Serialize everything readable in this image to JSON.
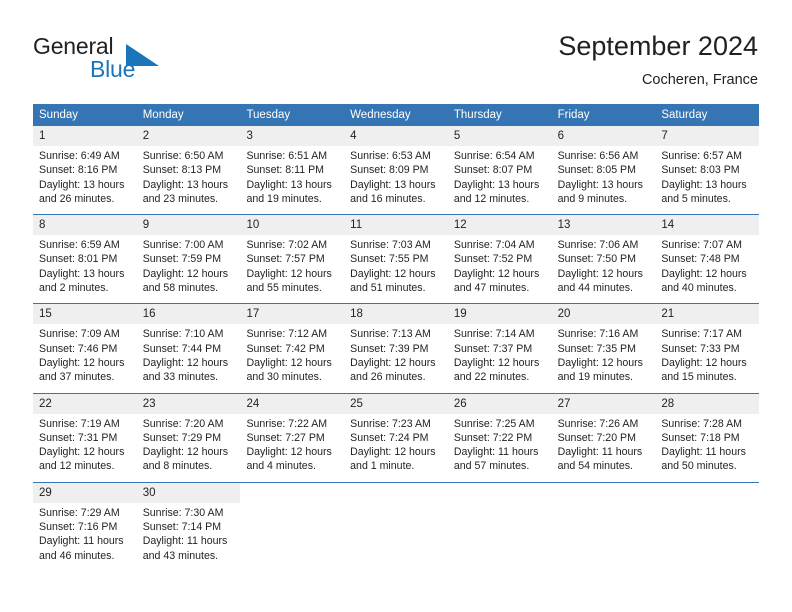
{
  "brand": {
    "word1": "General",
    "word2": "Blue",
    "mark_icon": "triangle-logo-icon",
    "colors": {
      "text": "#231f20",
      "blue": "#1b75bb"
    }
  },
  "header": {
    "title": "September 2024",
    "location": "Cocheren, France"
  },
  "theme": {
    "header_blue": "#3575b3",
    "day_band_gray": "#efefef",
    "text": "#231f20"
  },
  "weekdays": [
    "Sunday",
    "Monday",
    "Tuesday",
    "Wednesday",
    "Thursday",
    "Friday",
    "Saturday"
  ],
  "weeks": [
    [
      {
        "day": "1",
        "sunrise": "Sunrise: 6:49 AM",
        "sunset": "Sunset: 8:16 PM",
        "daylight": "Daylight: 13 hours and 26 minutes."
      },
      {
        "day": "2",
        "sunrise": "Sunrise: 6:50 AM",
        "sunset": "Sunset: 8:13 PM",
        "daylight": "Daylight: 13 hours and 23 minutes."
      },
      {
        "day": "3",
        "sunrise": "Sunrise: 6:51 AM",
        "sunset": "Sunset: 8:11 PM",
        "daylight": "Daylight: 13 hours and 19 minutes."
      },
      {
        "day": "4",
        "sunrise": "Sunrise: 6:53 AM",
        "sunset": "Sunset: 8:09 PM",
        "daylight": "Daylight: 13 hours and 16 minutes."
      },
      {
        "day": "5",
        "sunrise": "Sunrise: 6:54 AM",
        "sunset": "Sunset: 8:07 PM",
        "daylight": "Daylight: 13 hours and 12 minutes."
      },
      {
        "day": "6",
        "sunrise": "Sunrise: 6:56 AM",
        "sunset": "Sunset: 8:05 PM",
        "daylight": "Daylight: 13 hours and 9 minutes."
      },
      {
        "day": "7",
        "sunrise": "Sunrise: 6:57 AM",
        "sunset": "Sunset: 8:03 PM",
        "daylight": "Daylight: 13 hours and 5 minutes."
      }
    ],
    [
      {
        "day": "8",
        "sunrise": "Sunrise: 6:59 AM",
        "sunset": "Sunset: 8:01 PM",
        "daylight": "Daylight: 13 hours and 2 minutes."
      },
      {
        "day": "9",
        "sunrise": "Sunrise: 7:00 AM",
        "sunset": "Sunset: 7:59 PM",
        "daylight": "Daylight: 12 hours and 58 minutes."
      },
      {
        "day": "10",
        "sunrise": "Sunrise: 7:02 AM",
        "sunset": "Sunset: 7:57 PM",
        "daylight": "Daylight: 12 hours and 55 minutes."
      },
      {
        "day": "11",
        "sunrise": "Sunrise: 7:03 AM",
        "sunset": "Sunset: 7:55 PM",
        "daylight": "Daylight: 12 hours and 51 minutes."
      },
      {
        "day": "12",
        "sunrise": "Sunrise: 7:04 AM",
        "sunset": "Sunset: 7:52 PM",
        "daylight": "Daylight: 12 hours and 47 minutes."
      },
      {
        "day": "13",
        "sunrise": "Sunrise: 7:06 AM",
        "sunset": "Sunset: 7:50 PM",
        "daylight": "Daylight: 12 hours and 44 minutes."
      },
      {
        "day": "14",
        "sunrise": "Sunrise: 7:07 AM",
        "sunset": "Sunset: 7:48 PM",
        "daylight": "Daylight: 12 hours and 40 minutes."
      }
    ],
    [
      {
        "day": "15",
        "sunrise": "Sunrise: 7:09 AM",
        "sunset": "Sunset: 7:46 PM",
        "daylight": "Daylight: 12 hours and 37 minutes."
      },
      {
        "day": "16",
        "sunrise": "Sunrise: 7:10 AM",
        "sunset": "Sunset: 7:44 PM",
        "daylight": "Daylight: 12 hours and 33 minutes."
      },
      {
        "day": "17",
        "sunrise": "Sunrise: 7:12 AM",
        "sunset": "Sunset: 7:42 PM",
        "daylight": "Daylight: 12 hours and 30 minutes."
      },
      {
        "day": "18",
        "sunrise": "Sunrise: 7:13 AM",
        "sunset": "Sunset: 7:39 PM",
        "daylight": "Daylight: 12 hours and 26 minutes."
      },
      {
        "day": "19",
        "sunrise": "Sunrise: 7:14 AM",
        "sunset": "Sunset: 7:37 PM",
        "daylight": "Daylight: 12 hours and 22 minutes."
      },
      {
        "day": "20",
        "sunrise": "Sunrise: 7:16 AM",
        "sunset": "Sunset: 7:35 PM",
        "daylight": "Daylight: 12 hours and 19 minutes."
      },
      {
        "day": "21",
        "sunrise": "Sunrise: 7:17 AM",
        "sunset": "Sunset: 7:33 PM",
        "daylight": "Daylight: 12 hours and 15 minutes."
      }
    ],
    [
      {
        "day": "22",
        "sunrise": "Sunrise: 7:19 AM",
        "sunset": "Sunset: 7:31 PM",
        "daylight": "Daylight: 12 hours and 12 minutes."
      },
      {
        "day": "23",
        "sunrise": "Sunrise: 7:20 AM",
        "sunset": "Sunset: 7:29 PM",
        "daylight": "Daylight: 12 hours and 8 minutes."
      },
      {
        "day": "24",
        "sunrise": "Sunrise: 7:22 AM",
        "sunset": "Sunset: 7:27 PM",
        "daylight": "Daylight: 12 hours and 4 minutes."
      },
      {
        "day": "25",
        "sunrise": "Sunrise: 7:23 AM",
        "sunset": "Sunset: 7:24 PM",
        "daylight": "Daylight: 12 hours and 1 minute."
      },
      {
        "day": "26",
        "sunrise": "Sunrise: 7:25 AM",
        "sunset": "Sunset: 7:22 PM",
        "daylight": "Daylight: 11 hours and 57 minutes."
      },
      {
        "day": "27",
        "sunrise": "Sunrise: 7:26 AM",
        "sunset": "Sunset: 7:20 PM",
        "daylight": "Daylight: 11 hours and 54 minutes."
      },
      {
        "day": "28",
        "sunrise": "Sunrise: 7:28 AM",
        "sunset": "Sunset: 7:18 PM",
        "daylight": "Daylight: 11 hours and 50 minutes."
      }
    ],
    [
      {
        "day": "29",
        "sunrise": "Sunrise: 7:29 AM",
        "sunset": "Sunset: 7:16 PM",
        "daylight": "Daylight: 11 hours and 46 minutes."
      },
      {
        "day": "30",
        "sunrise": "Sunrise: 7:30 AM",
        "sunset": "Sunset: 7:14 PM",
        "daylight": "Daylight: 11 hours and 43 minutes."
      },
      {
        "day": "",
        "sunrise": "",
        "sunset": "",
        "daylight": ""
      },
      {
        "day": "",
        "sunrise": "",
        "sunset": "",
        "daylight": ""
      },
      {
        "day": "",
        "sunrise": "",
        "sunset": "",
        "daylight": ""
      },
      {
        "day": "",
        "sunrise": "",
        "sunset": "",
        "daylight": ""
      },
      {
        "day": "",
        "sunrise": "",
        "sunset": "",
        "daylight": ""
      }
    ]
  ]
}
